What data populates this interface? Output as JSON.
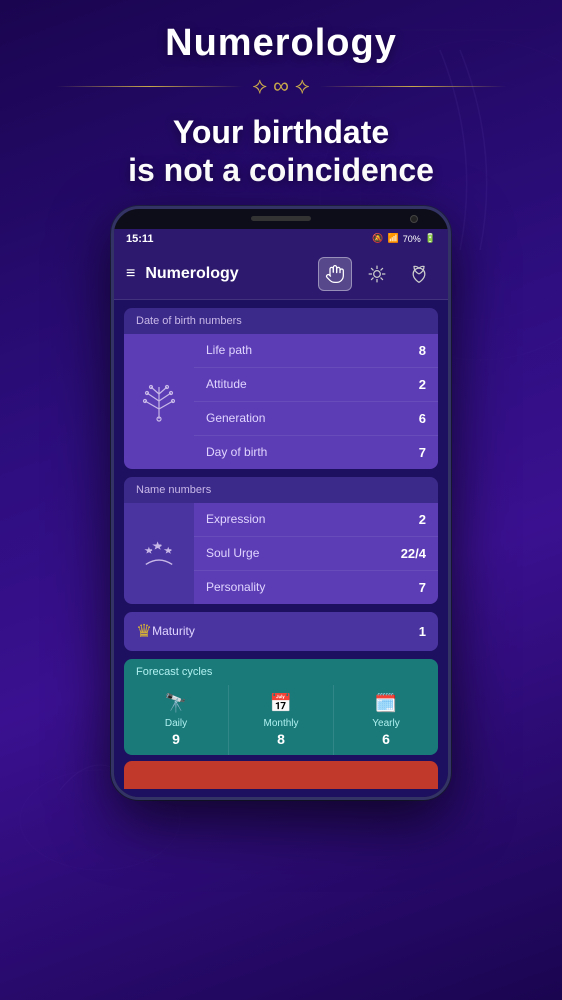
{
  "app": {
    "title": "Numerology",
    "subtitle": "Your birthdate\nis not a coincidence",
    "name": "Numerology",
    "status": {
      "time": "15:11",
      "battery": "70%",
      "icons": "🔕 📶"
    }
  },
  "header": {
    "menu_icon": "≡",
    "tabs": [
      {
        "label": "hand",
        "active": true
      },
      {
        "label": "astrology",
        "active": false
      },
      {
        "label": "lotus",
        "active": false
      }
    ]
  },
  "sections": {
    "date_of_birth": {
      "title": "Date of birth numbers",
      "rows": [
        {
          "label": "Life path",
          "value": "8"
        },
        {
          "label": "Attitude",
          "value": "2"
        },
        {
          "label": "Generation",
          "value": "6"
        },
        {
          "label": "Day of birth",
          "value": "7"
        }
      ]
    },
    "name_numbers": {
      "title": "Name numbers",
      "rows": [
        {
          "label": "Expression",
          "value": "2"
        },
        {
          "label": "Soul Urge",
          "value": "22/4"
        },
        {
          "label": "Personality",
          "value": "7"
        }
      ]
    },
    "maturity": {
      "label": "Maturity",
      "value": "1"
    },
    "forecast": {
      "title": "Forecast cycles",
      "items": [
        {
          "label": "Daily",
          "value": "9",
          "icon": "🔭"
        },
        {
          "label": "Monthly",
          "value": "8",
          "icon": ""
        },
        {
          "label": "Yearly",
          "value": "6",
          "icon": ""
        }
      ]
    }
  },
  "ornament": {
    "symbol": "∞"
  }
}
